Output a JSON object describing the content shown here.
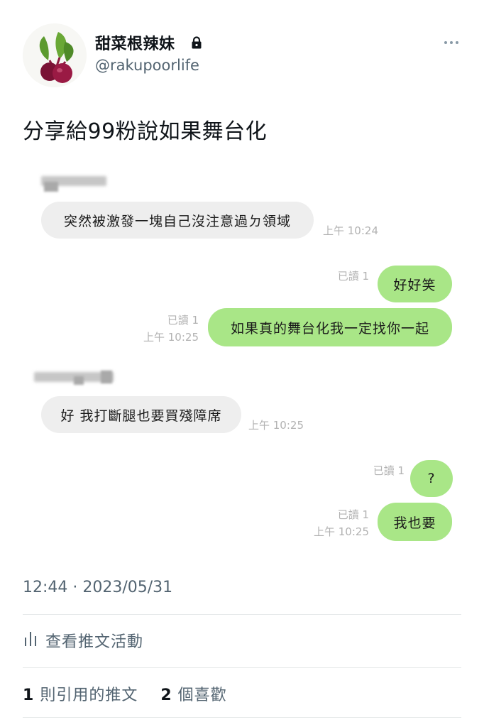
{
  "author": {
    "display_name": "甜菜根辣妹",
    "handle": "@rakupoorlife",
    "avatar_icon": "beetroot-icon",
    "protected_icon": "lock-icon"
  },
  "tweet": {
    "text": "分享給99粉說如果舞台化"
  },
  "chat": {
    "messages": [
      {
        "side": "in",
        "text": "突然被激發一塊自己沒注意過ㄉ領域",
        "time": "上午 10:24"
      },
      {
        "side": "out",
        "text": "好好笑",
        "read": "已讀 1"
      },
      {
        "side": "out",
        "text": "如果真的舞台化我一定找你一起",
        "read": "已讀 1",
        "time": "上午 10:25"
      },
      {
        "side": "in",
        "text": "好 我打斷腿也要買殘障席",
        "time": "上午 10:25"
      },
      {
        "side": "out",
        "text": "?",
        "read": "已讀 1"
      },
      {
        "side": "out",
        "text": "我也要",
        "read": "已讀 1",
        "time": "上午 10:25"
      }
    ]
  },
  "footer": {
    "timestamp": "12:44 · 2023/05/31",
    "analytics_label": "查看推文活動",
    "quote_count": "1",
    "quote_label": "則引用的推文",
    "like_count": "2",
    "like_label": "個喜歡"
  },
  "colors": {
    "outgoing_bubble": "#a9e687",
    "incoming_bubble": "#eeeeee",
    "secondary_text": "#536471"
  }
}
